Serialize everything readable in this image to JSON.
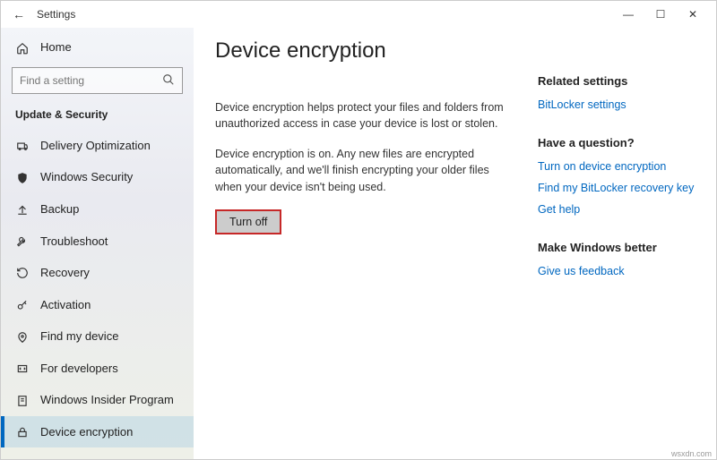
{
  "window": {
    "title": "Settings"
  },
  "sidebar": {
    "home": "Home",
    "search_placeholder": "Find a setting",
    "section": "Update & Security",
    "items": [
      {
        "label": "Delivery Optimization"
      },
      {
        "label": "Windows Security"
      },
      {
        "label": "Backup"
      },
      {
        "label": "Troubleshoot"
      },
      {
        "label": "Recovery"
      },
      {
        "label": "Activation"
      },
      {
        "label": "Find my device"
      },
      {
        "label": "For developers"
      },
      {
        "label": "Windows Insider Program"
      },
      {
        "label": "Device encryption"
      }
    ]
  },
  "main": {
    "heading": "Device encryption",
    "p1": "Device encryption helps protect your files and folders from unauthorized access in case your device is lost or stolen.",
    "p2": "Device encryption is on. Any new files are encrypted automatically, and we'll finish encrypting your older files when your device isn't being used.",
    "button": "Turn off"
  },
  "rail": {
    "related_h": "Related settings",
    "related_link": "BitLocker settings",
    "question_h": "Have a question?",
    "q_links": {
      "a": "Turn on device encryption",
      "b": "Find my BitLocker recovery key",
      "c": "Get help"
    },
    "better_h": "Make Windows better",
    "feedback": "Give us feedback"
  },
  "watermark": "wsxdn.com"
}
